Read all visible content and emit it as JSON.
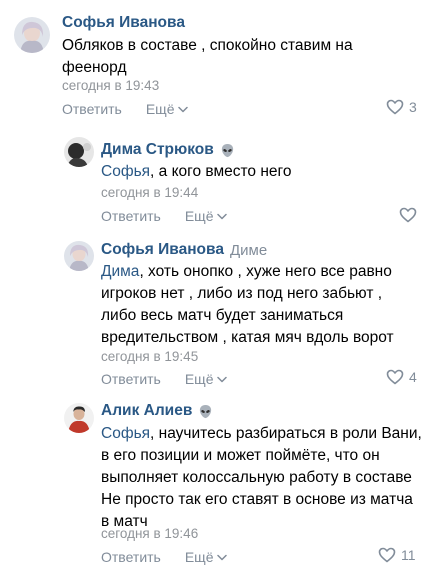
{
  "comments": [
    {
      "author": "Софья Иванова",
      "reply_to": "",
      "mention": "",
      "lines": [
        "Обляков в составе , спокойно ставим на",
        "феенорд"
      ],
      "time": "сегодня в 19:43",
      "reply_label": "Ответить",
      "more_label": "Ещё",
      "likes": "3"
    },
    {
      "author": "Дима Стрюков",
      "reply_to": "",
      "mention": "Софья",
      "lines": [
        ", а кого вместо него"
      ],
      "time": "сегодня в 19:44",
      "reply_label": "Ответить",
      "more_label": "Ещё",
      "likes": ""
    },
    {
      "author": "Софья Иванова",
      "reply_to": "Диме",
      "mention": "Дима",
      "lines": [
        ", хоть онопко , хуже него все равно",
        "игроков нет , либо из под него забьют ,",
        "либо весь матч будет заниматься",
        "вредительством , катая мяч вдоль ворот"
      ],
      "time": "сегодня в 19:45",
      "reply_label": "Ответить",
      "more_label": "Ещё",
      "likes": "4"
    },
    {
      "author": "Алик Алиев",
      "reply_to": "",
      "mention": "Софья",
      "lines": [
        ", научитесь разбираться в роли Вани,",
        "в его позиции и может поймёте, что он",
        "выполняет колоссальную работу в составе",
        "Не просто так его ставят в основе из матча",
        "в матч"
      ],
      "time": "сегодня в 19:46",
      "reply_label": "Ответить",
      "more_label": "Ещё",
      "likes": "11"
    }
  ],
  "colors": {
    "author": "#2a5885",
    "secondary": "#818c99",
    "time": "#909499"
  },
  "icons": {
    "alien": "alien-emoji-icon",
    "like": "heart-outline-icon",
    "more": "chevron-down-icon"
  }
}
